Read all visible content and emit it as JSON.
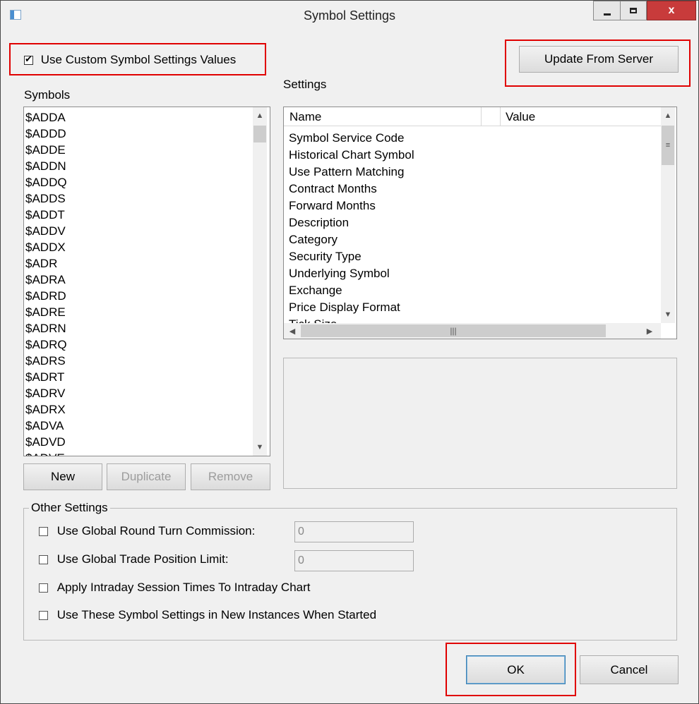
{
  "window": {
    "title": "Symbol Settings",
    "close_label": "x"
  },
  "custom_settings": {
    "label": "Use Custom Symbol Settings Values",
    "checked": true
  },
  "update_button": "Update From Server",
  "symbols": {
    "label": "Symbols",
    "items": [
      "$ADDA",
      "$ADDD",
      "$ADDE",
      "$ADDN",
      "$ADDQ",
      "$ADDS",
      "$ADDT",
      "$ADDV",
      "$ADDX",
      "$ADR",
      "$ADRA",
      "$ADRD",
      "$ADRE",
      "$ADRN",
      "$ADRQ",
      "$ADRS",
      "$ADRT",
      "$ADRV",
      "$ADRX",
      "$ADVA",
      "$ADVD",
      "$ADVE"
    ],
    "new_button": "New",
    "duplicate_button": "Duplicate",
    "remove_button": "Remove"
  },
  "settings": {
    "label": "Settings",
    "columns": [
      "Name",
      "Value"
    ],
    "rows": [
      "Symbol Service Code",
      "Historical Chart Symbol",
      "Use Pattern Matching",
      "Contract Months",
      "Forward Months",
      "Description",
      "Category",
      "Security Type",
      "Underlying Symbol",
      "Exchange",
      "Price Display Format",
      "Tick Size"
    ]
  },
  "other_settings": {
    "label": "Other Settings",
    "round_turn_commission": {
      "label": "Use Global Round Turn Commission:",
      "value": "0"
    },
    "trade_position_limit": {
      "label": "Use Global Trade Position Limit:",
      "value": "0"
    },
    "intraday_session": {
      "label": "Apply Intraday Session Times To Intraday Chart"
    },
    "new_instances": {
      "label": "Use These Symbol Settings in New Instances When Started"
    }
  },
  "footer": {
    "ok_label": "OK",
    "cancel_label": "Cancel"
  }
}
